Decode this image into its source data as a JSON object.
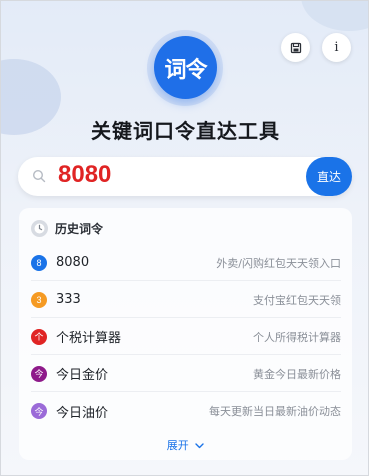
{
  "app": {
    "logo_text": "词令",
    "title": "关键词口令直达工具"
  },
  "header_buttons": {
    "save_icon": "save-icon",
    "info_label": "i"
  },
  "search": {
    "value": "8080",
    "button_label": "直达",
    "icon": "search-icon"
  },
  "history": {
    "title": "历史词令",
    "expand_label": "展开",
    "items": [
      {
        "badge": "8",
        "badge_color": "#1a73e8",
        "name": "8080",
        "desc": "外卖/闪购红包天天领入口"
      },
      {
        "badge": "3",
        "badge_color": "#f59a23",
        "name": "333",
        "desc": "支付宝红包天天领"
      },
      {
        "badge": "个",
        "badge_color": "#e02424",
        "name": "个税计算器",
        "desc": "个人所得税计算器"
      },
      {
        "badge": "今",
        "badge_color": "#8e1a8a",
        "name": "今日金价",
        "desc": "黄金今日最新价格"
      },
      {
        "badge": "今",
        "badge_color": "#9b6bd8",
        "name": "今日油价",
        "desc": "每天更新当日最新油价动态"
      }
    ]
  },
  "colors": {
    "accent": "#1a73e8",
    "search_value": "#e02424"
  }
}
